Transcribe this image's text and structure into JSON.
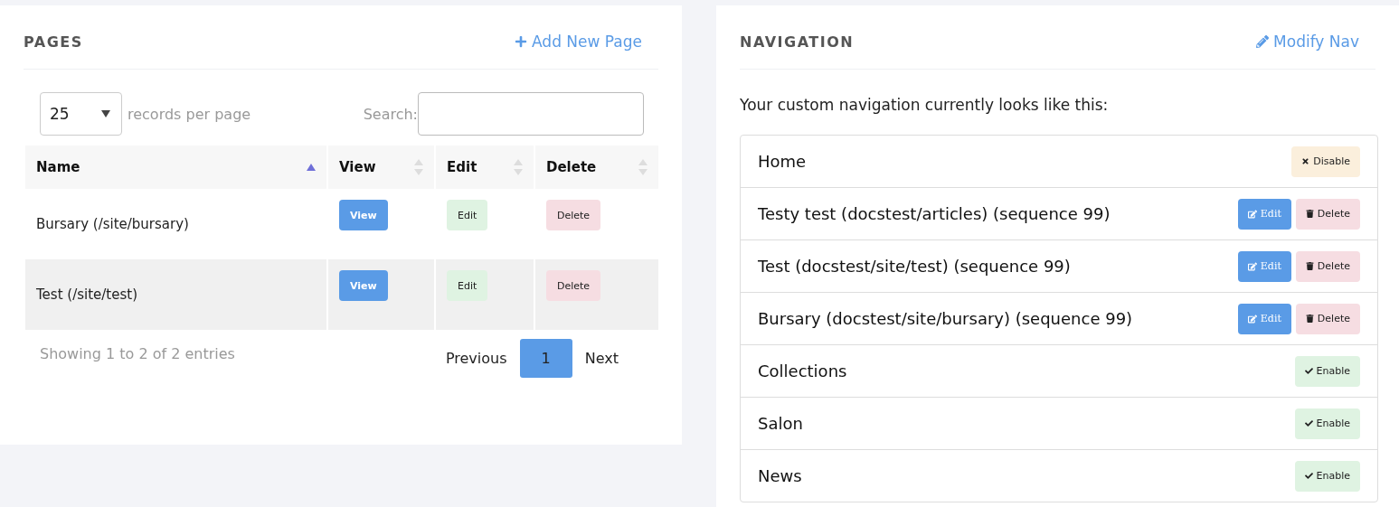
{
  "pages": {
    "title": "PAGES",
    "action": {
      "label": "Add New Page"
    },
    "length": {
      "value": "25",
      "suffix": "records per page"
    },
    "search": {
      "label": "Search:"
    },
    "columns": [
      {
        "label": "Name",
        "sorted": true
      },
      {
        "label": "View",
        "sorted": false
      },
      {
        "label": "Edit",
        "sorted": false
      },
      {
        "label": "Delete",
        "sorted": false
      }
    ],
    "rows": [
      {
        "name": "Bursary (/site/bursary)",
        "view": "View",
        "edit": "Edit",
        "delete": "Delete"
      },
      {
        "name": "Test (/site/test)",
        "view": "View",
        "edit": "Edit",
        "delete": "Delete"
      }
    ],
    "info": "Showing 1 to 2 of 2 entries",
    "pagination": [
      {
        "label": "Previous",
        "selected": false
      },
      {
        "label": "1",
        "selected": true
      },
      {
        "label": "Next",
        "selected": false
      }
    ]
  },
  "navigation": {
    "title": "NAVIGATION",
    "action": {
      "label": "Modify Nav"
    },
    "intro": "Your custom navigation currently looks like this:",
    "items": [
      {
        "label": "Home",
        "buttons": [
          {
            "kind": "disable",
            "label": "Disable"
          }
        ]
      },
      {
        "label": "Testy test (docstest/articles) (sequence 99)",
        "buttons": [
          {
            "kind": "edit",
            "label": "Edit"
          },
          {
            "kind": "delete",
            "label": "Delete"
          }
        ]
      },
      {
        "label": "Test (docstest/site/test) (sequence 99)",
        "buttons": [
          {
            "kind": "edit",
            "label": "Edit"
          },
          {
            "kind": "delete",
            "label": "Delete"
          }
        ]
      },
      {
        "label": "Bursary (docstest/site/bursary) (sequence 99)",
        "buttons": [
          {
            "kind": "edit",
            "label": "Edit"
          },
          {
            "kind": "delete",
            "label": "Delete"
          }
        ]
      },
      {
        "label": "Collections",
        "buttons": [
          {
            "kind": "enable",
            "label": "Enable"
          }
        ]
      },
      {
        "label": "Salon",
        "buttons": [
          {
            "kind": "enable",
            "label": "Enable"
          }
        ]
      },
      {
        "label": "News",
        "buttons": [
          {
            "kind": "enable",
            "label": "Enable"
          }
        ]
      }
    ]
  }
}
